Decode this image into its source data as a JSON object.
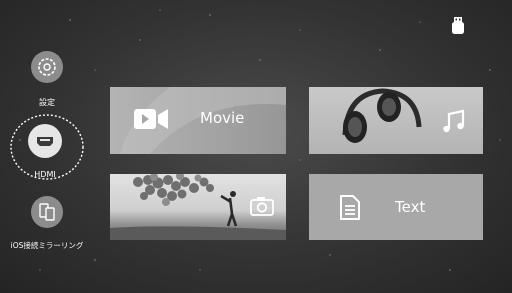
{
  "sidebar": {
    "items": [
      {
        "label": "設定",
        "icon": "gear-icon"
      },
      {
        "label": "HDMI",
        "icon": "hdmi-icon",
        "selected": true
      },
      {
        "label": "iOS接続ミラーリング",
        "icon": "mirroring-icon"
      }
    ]
  },
  "status": {
    "icon": "usb-icon"
  },
  "tiles": {
    "movie": {
      "label": "Movie",
      "icon": "video-camera-icon"
    },
    "music": {
      "icon": "music-note-icon",
      "image": "headphones"
    },
    "photo": {
      "icon": "camera-icon",
      "image": "balloons"
    },
    "text": {
      "label": "Text",
      "icon": "document-icon"
    }
  },
  "colors": {
    "tile_gray": "#aaaaaa",
    "background": "#333333",
    "selection_ring": "#ffffff"
  }
}
